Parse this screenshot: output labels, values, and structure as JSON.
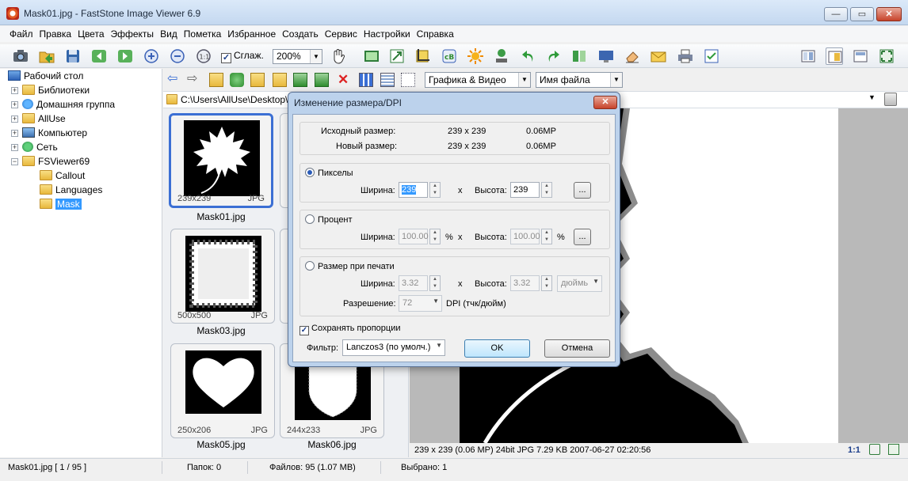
{
  "window": {
    "title": "Mask01.jpg  -  FastStone Image Viewer 6.9",
    "min": "—",
    "max": "▭",
    "close": "✕"
  },
  "menu": [
    "Файл",
    "Правка",
    "Цвета",
    "Эффекты",
    "Вид",
    "Пометка",
    "Избранное",
    "Создать",
    "Сервис",
    "Настройки",
    "Справка"
  ],
  "toolbar": {
    "smooth_label": "Сглаж.",
    "smooth_checked": "✓",
    "zoom": "200%"
  },
  "tree": {
    "items": [
      {
        "label": "Рабочий стол"
      },
      {
        "label": "Библиотеки"
      },
      {
        "label": "Домашняя группа"
      },
      {
        "label": "AllUse"
      },
      {
        "label": "Компьютер"
      },
      {
        "label": "Сеть"
      },
      {
        "label": "FSViewer69"
      },
      {
        "label": "Callout"
      },
      {
        "label": "Languages"
      },
      {
        "label": "Mask"
      }
    ]
  },
  "browser": {
    "filter": "Графика & Видео",
    "sort": "Имя файла",
    "path": "C:\\Users\\AllUse\\Desktop\\"
  },
  "thumbnails": [
    {
      "name": "Mask01.jpg",
      "size": "239x239",
      "type": "JPG"
    },
    {
      "name": "Mask03.jpg",
      "size": "500x500",
      "type": "JPG"
    },
    {
      "name": "Mask05.jpg",
      "size": "250x206",
      "type": "JPG"
    },
    {
      "name": "Mask06.jpg",
      "size": "244x233",
      "type": "JPG"
    }
  ],
  "image_info": "239 x 239 (0.06 MP)   24bit  JPG   7.29 KB   2007-06-27 02:20:56",
  "image_info_right": "1:1",
  "status": {
    "file": "Mask01.jpg [ 1 / 95 ]",
    "folders": "Папок: 0",
    "files": "Файлов: 95 (1.07 MB)",
    "selected": "Выбрано: 1"
  },
  "dialog": {
    "title": "Изменение размера/DPI",
    "orig_label": "Исходный размер:",
    "orig_size": "239 x 239",
    "orig_mp": "0.06MP",
    "new_label": "Новый размер:",
    "new_size": "239 x 239",
    "new_mp": "0.06MP",
    "pixels": {
      "label": "Пикселы",
      "width_label": "Ширина:",
      "width": "239",
      "x": "x",
      "height_label": "Высота:",
      "height": "239",
      "more": "..."
    },
    "percent": {
      "label": "Процент",
      "width_label": "Ширина:",
      "width": "100.00",
      "unit": "%",
      "x": "x",
      "height_label": "Высота:",
      "height": "100.00",
      "more": "..."
    },
    "print": {
      "label": "Размер при печати",
      "width_label": "Ширина:",
      "width": "3.32",
      "x": "x",
      "height_label": "Высота:",
      "height": "3.32",
      "unit": "дюймь",
      "res_label": "Разрешение:",
      "res": "72",
      "res_unit": "DPI (тчк/дюйм)"
    },
    "keep_ratio": "Сохранять пропорции",
    "filter_label": "Фильтр:",
    "filter": "Lanczos3 (по умолч.)",
    "ok": "OK",
    "cancel": "Отмена"
  }
}
